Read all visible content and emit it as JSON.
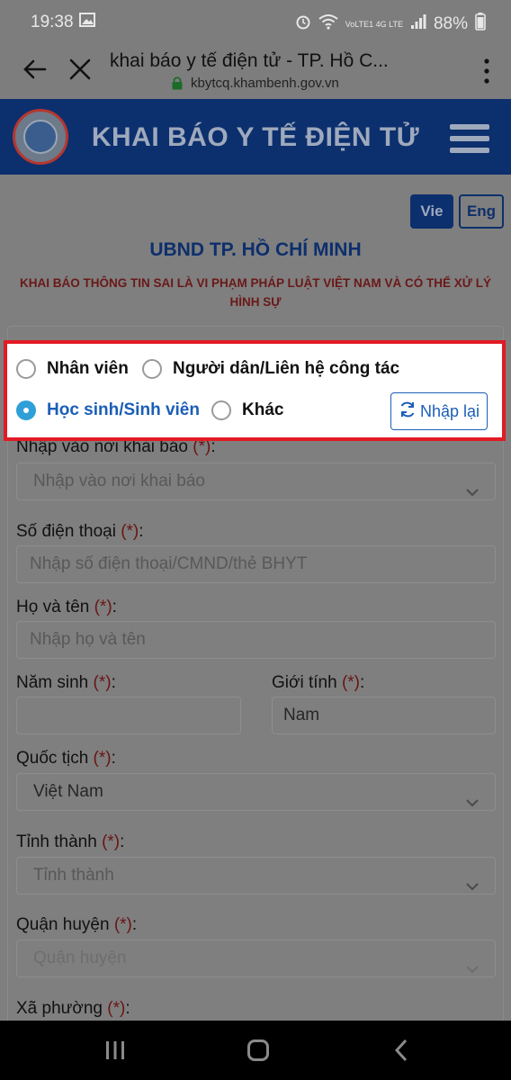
{
  "status_bar": {
    "time": "19:38",
    "battery": "88%",
    "network": "VoLTE1 4G LTE"
  },
  "browser": {
    "page_title": "khai báo y tế điện tử - TP. Hồ C...",
    "url": "kbytcq.khambenh.gov.vn"
  },
  "header": {
    "app_title": "KHAI BÁO Y TẾ ĐIỆN TỬ"
  },
  "language": {
    "vie": "Vie",
    "eng": "Eng",
    "selected": "Vie"
  },
  "unit_title": "UBND TP. HỒ CHÍ MINH",
  "warning": "KHAI BÁO THÔNG TIN SAI LÀ VI PHẠM PHÁP LUẬT VIỆT NAM VÀ CÓ THỂ XỬ LÝ HÌNH SỰ",
  "radio_options": [
    {
      "label": "Nhân viên",
      "checked": false
    },
    {
      "label": "Người dân/Liên hệ công tác",
      "checked": false
    },
    {
      "label": "Học sinh/Sinh viên",
      "checked": true
    },
    {
      "label": "Khác",
      "checked": false
    }
  ],
  "reset_button": "Nhập lại",
  "required_mark": "(*)",
  "fields": {
    "location": {
      "label": "Nhập vào nơi khai báo",
      "placeholder": "Nhập vào nơi khai báo"
    },
    "phone": {
      "label": "Số điện thoại",
      "placeholder": "Nhập số điện thoại/CMND/thẻ BHYT"
    },
    "fullname": {
      "label": "Họ và tên",
      "placeholder": "Nhập họ và tên"
    },
    "birth_year": {
      "label": "Năm sinh",
      "value": ""
    },
    "gender": {
      "label": "Giới tính",
      "value": "Nam"
    },
    "nationality": {
      "label": "Quốc tịch",
      "value": "Việt Nam"
    },
    "province": {
      "label": "Tỉnh thành",
      "placeholder": "Tỉnh thành"
    },
    "district": {
      "label": "Quận huyện",
      "placeholder": "Quận huyện"
    },
    "ward": {
      "label": "Xã phường"
    }
  },
  "colors": {
    "header_blue": "#0c2f6e",
    "highlight_red": "#e21a24",
    "radio_selected": "#2f9fd8",
    "link_blue": "#1b5eb7"
  }
}
